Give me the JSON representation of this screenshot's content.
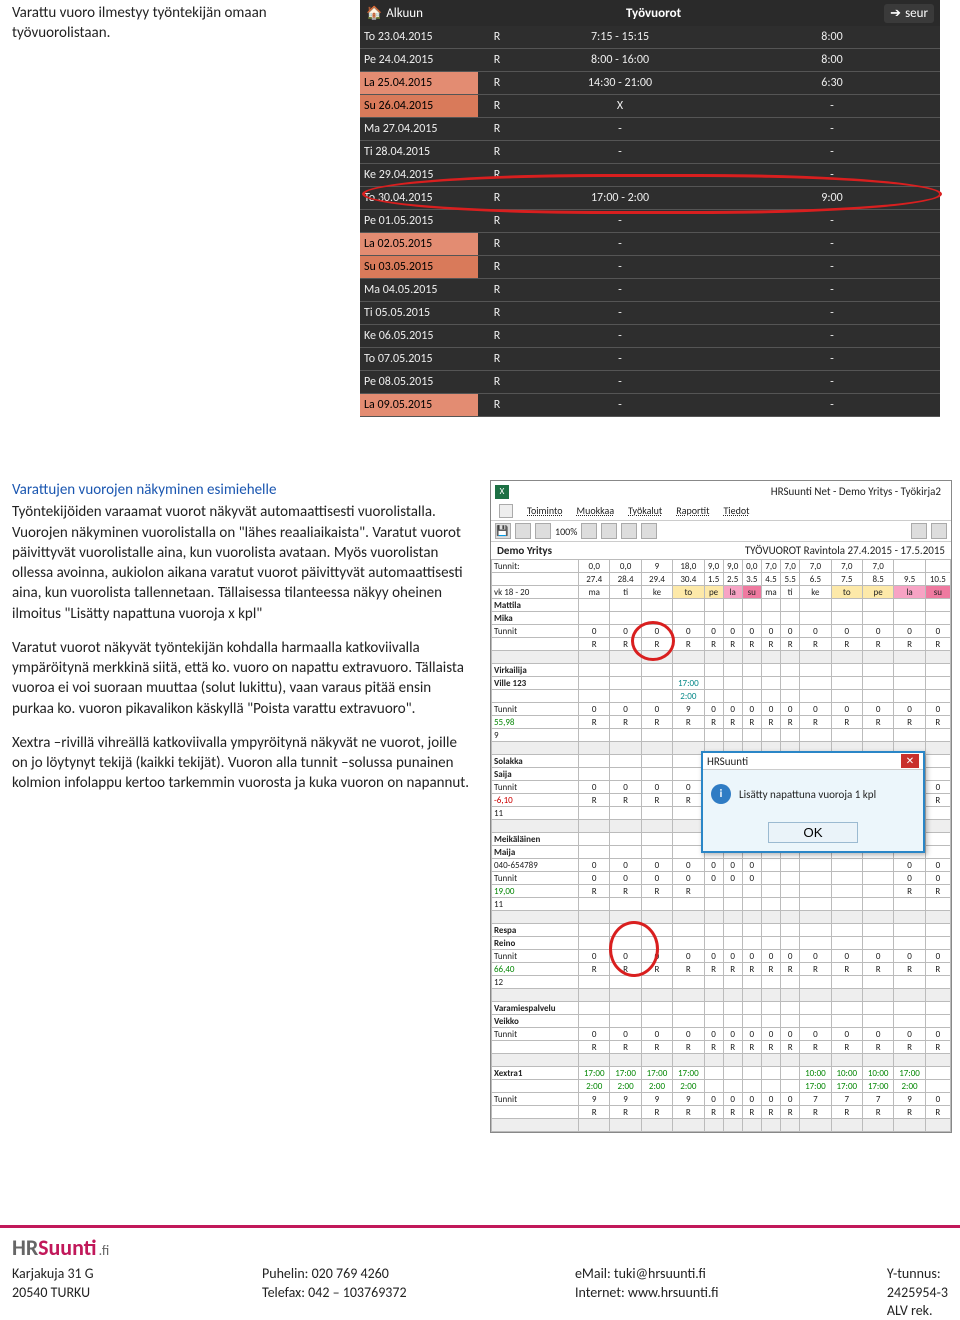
{
  "caption_left": "Varattu vuoro ilmestyy työntekijän omaan työvuorolistaan.",
  "mobile": {
    "home": "Alkuun",
    "title": "Työvuorot",
    "next": "seur",
    "rows": [
      {
        "date": "To 23.04.2015",
        "col": "R",
        "time": "7:15 - 15:15",
        "h": "8:00",
        "cls": "mrow"
      },
      {
        "date": "Pe 24.04.2015",
        "col": "R",
        "time": "8:00 - 16:00",
        "h": "8:00",
        "cls": "mrow"
      },
      {
        "date": "La 25.04.2015",
        "col": "R",
        "time": "14:30 - 21:00",
        "h": "6:30",
        "cls": "mrow weekend"
      },
      {
        "date": "Su 26.04.2015",
        "col": "R",
        "time": "X",
        "h": "-",
        "cls": "mrow sunday"
      },
      {
        "date": "Ma 27.04.2015",
        "col": "R",
        "time": "-",
        "h": "-",
        "cls": "mrow"
      },
      {
        "date": "Ti 28.04.2015",
        "col": "R",
        "time": "-",
        "h": "-",
        "cls": "mrow"
      },
      {
        "date": "Ke 29.04.2015",
        "col": "R",
        "time": "-",
        "h": "-",
        "cls": "mrow"
      },
      {
        "date": "To 30.04.2015",
        "col": "R",
        "time": "17:00 - 2:00",
        "h": "9:00",
        "cls": "mrow"
      },
      {
        "date": "Pe 01.05.2015",
        "col": "R",
        "time": "-",
        "h": "-",
        "cls": "mrow"
      },
      {
        "date": "La 02.05.2015",
        "col": "R",
        "time": "-",
        "h": "-",
        "cls": "mrow weekend"
      },
      {
        "date": "Su 03.05.2015",
        "col": "R",
        "time": "-",
        "h": "-",
        "cls": "mrow sunday"
      },
      {
        "date": "Ma 04.05.2015",
        "col": "R",
        "time": "-",
        "h": "-",
        "cls": "mrow"
      },
      {
        "date": "Ti 05.05.2015",
        "col": "R",
        "time": "-",
        "h": "-",
        "cls": "mrow"
      },
      {
        "date": "Ke 06.05.2015",
        "col": "R",
        "time": "-",
        "h": "-",
        "cls": "mrow"
      },
      {
        "date": "To 07.05.2015",
        "col": "R",
        "time": "-",
        "h": "-",
        "cls": "mrow"
      },
      {
        "date": "Pe 08.05.2015",
        "col": "R",
        "time": "-",
        "h": "-",
        "cls": "mrow"
      },
      {
        "date": "La 09.05.2015",
        "col": "R",
        "time": "-",
        "h": "-",
        "cls": "mrow weekend"
      }
    ]
  },
  "heading_blue": "Varattujen vuorojen näkyminen esimiehelle",
  "para1": "Työntekijöiden varaamat vuorot näkyvät automaattisesti vuorolistalla. Vuorojen näkyminen vuorolistalla on \"lähes reaaliaikaista\". Varatut vuorot päivittyvät vuorolistalle aina, kun vuorolista avataan. Myös vuorolistan ollessa avoinna, aukiolon aikana varatut vuorot päivittyvät automaattisesti aina, kun vuorolista tallennetaan. Tällaisessa tilanteessa näkyy oheinen ilmoitus \"Lisätty napattuna vuoroja x kpl\"",
  "para2": "Varatut vuorot näkyvät työntekijän kohdalla harmaalla katkoviivalla ympäröitynä merkkinä siitä, että ko. vuoro on napattu extravuoro. Tällaista vuoroa ei voi suoraan muuttaa (solut lukittu), vaan varaus pitää ensin purkaa ko. vuoron pikavalikon käskyllä \"Poista varattu extravuoro\".",
  "para3": "Xextra –rivillä vihreällä katkoviivalla ympyröitynä näkyvät ne vuorot, joille on jo löytynyt tekijä (kaikki tekijät). Vuoron alla tunnit –solussa punainen kolmion infolappu kertoo tarkemmin vuorosta ja kuka vuoron on napannut.",
  "desk": {
    "title": "HRSuunti Net  -  Demo Yritys - Työkirja2",
    "menus": [
      "Toiminto",
      "Muokkaa",
      "Työkalut",
      "Raportit",
      "Tiedot"
    ],
    "zoom": "100%",
    "demo": "Demo Yritys",
    "period": "TYÖVUOROT Ravintola 27.4.2015 - 17.5.2015",
    "tunnit_label": "Tunnit:",
    "tunnit_row": [
      "0,0",
      "0,0",
      "9",
      "18,0",
      "9,0",
      "9,0",
      "0,0",
      "7,0",
      "7,0",
      "7,0",
      "7,0",
      "7,0"
    ],
    "dates_row": [
      "27.4",
      "28.4",
      "29.4",
      "30.4",
      "1.5",
      "2.5",
      "3.5",
      "4.5",
      "5.5",
      "6.5",
      "7.5",
      "8.5",
      "9.5",
      "10.5"
    ],
    "vk_label": "vk 18 - 20",
    "days_row": [
      "ma",
      "ti",
      "ke",
      "to",
      "pe",
      "la",
      "su",
      "ma",
      "ti",
      "ke",
      "to",
      "pe",
      "la",
      "su"
    ],
    "sections": [
      {
        "names": [
          "Mattila",
          "Mika"
        ],
        "t": [
          "0",
          "0",
          "0",
          "0",
          "0",
          "0",
          "0",
          "0",
          "0",
          "0",
          "0",
          "0",
          "0",
          "0"
        ],
        "r": [
          "R",
          "R",
          "R",
          "R",
          "R",
          "R",
          "R",
          "R",
          "R",
          "R",
          "R",
          "R",
          "R",
          "R"
        ]
      },
      {
        "names": [
          "Virkailija",
          "Ville 123"
        ],
        "extra": [
          "",
          "",
          "",
          "17:00",
          "",
          "",
          "",
          "",
          "",
          "",
          "",
          "",
          "",
          ""
        ],
        "extra2": [
          "",
          "",
          "",
          "2:00",
          "",
          "",
          "",
          "",
          "",
          "",
          "",
          "",
          "",
          ""
        ],
        "t": [
          "0",
          "0",
          "0",
          "9",
          "0",
          "0",
          "0",
          "0",
          "0",
          "0",
          "0",
          "0",
          "0",
          "0"
        ],
        "r": [
          "R",
          "R",
          "R",
          "R",
          "R",
          "R",
          "R",
          "R",
          "R",
          "R",
          "R",
          "R",
          "R",
          "R"
        ],
        "sum": "55,98",
        "sum2": "9"
      },
      {
        "names": [
          "Solakka",
          "Saija"
        ],
        "t": [
          "0",
          "0",
          "0",
          "0",
          "0",
          "0",
          "0",
          "",
          "",
          "",
          "",
          "",
          "0",
          "0"
        ],
        "r": [
          "R",
          "R",
          "R",
          "R",
          "",
          "",
          "",
          "",
          "",
          "",
          "",
          "",
          "R",
          "R"
        ],
        "sum": "-6,10",
        "sum2": "11"
      },
      {
        "names": [
          "Meikäläinen",
          "Maija"
        ],
        "phone": "040-654789",
        "t": [
          "0",
          "0",
          "0",
          "0",
          "0",
          "0",
          "0",
          "",
          "",
          "",
          "",
          "",
          "0",
          "0"
        ],
        "r": [
          "R",
          "R",
          "R",
          "R",
          "",
          "",
          "",
          "",
          "",
          "",
          "",
          "",
          "R",
          "R"
        ],
        "sum": "19,00",
        "sum2": "11"
      },
      {
        "names": [
          "Respa",
          "Reino"
        ],
        "t": [
          "0",
          "0",
          "0",
          "0",
          "0",
          "0",
          "0",
          "0",
          "0",
          "0",
          "0",
          "0",
          "0",
          "0"
        ],
        "r": [
          "R",
          "R",
          "R",
          "R",
          "R",
          "R",
          "R",
          "R",
          "R",
          "R",
          "R",
          "R",
          "R",
          "R"
        ],
        "sum": "66,40",
        "sum2": "12"
      },
      {
        "names": [
          "Varamiespalvelu",
          "Veikko"
        ],
        "t": [
          "0",
          "0",
          "0",
          "0",
          "0",
          "0",
          "0",
          "0",
          "0",
          "0",
          "0",
          "0",
          "0",
          "0"
        ],
        "r": [
          "R",
          "R",
          "R",
          "R",
          "R",
          "R",
          "R",
          "R",
          "R",
          "R",
          "R",
          "R",
          "R",
          "R"
        ]
      },
      {
        "names": [
          "Xextra1"
        ],
        "extra": [
          "17:00",
          "17:00",
          "17:00",
          "17:00",
          "",
          "",
          "",
          "",
          "",
          "10:00",
          "10:00",
          "10:00",
          "17:00",
          ""
        ],
        "extra2": [
          "2:00",
          "2:00",
          "2:00",
          "2:00",
          "",
          "",
          "",
          "",
          "",
          "17:00",
          "17:00",
          "17:00",
          "2:00",
          ""
        ],
        "t": [
          "9",
          "9",
          "9",
          "9",
          "0",
          "0",
          "0",
          "0",
          "0",
          "7",
          "7",
          "7",
          "9",
          "0"
        ],
        "r": [
          "R",
          "R",
          "R",
          "R",
          "R",
          "R",
          "R",
          "R",
          "R",
          "R",
          "R",
          "R",
          "R",
          "R"
        ]
      }
    ],
    "modal": {
      "title": "HRSuunti",
      "message": "Lisätty napattuna vuoroja 1 kpl",
      "ok": "OK"
    }
  },
  "footer": {
    "addr1": "Karjakuja 31 G",
    "addr2": "20540 TURKU",
    "tel1": "Puhelin: 020 769 4260",
    "tel2": "Telefax: 042 – 103769372",
    "mail": "eMail: tuki@hrsuunti.fi",
    "web": "Internet: www.hrsuunti.fi",
    "y1": "Y-tunnus:",
    "y2": "2425954-3",
    "y3": "ALV rek."
  }
}
